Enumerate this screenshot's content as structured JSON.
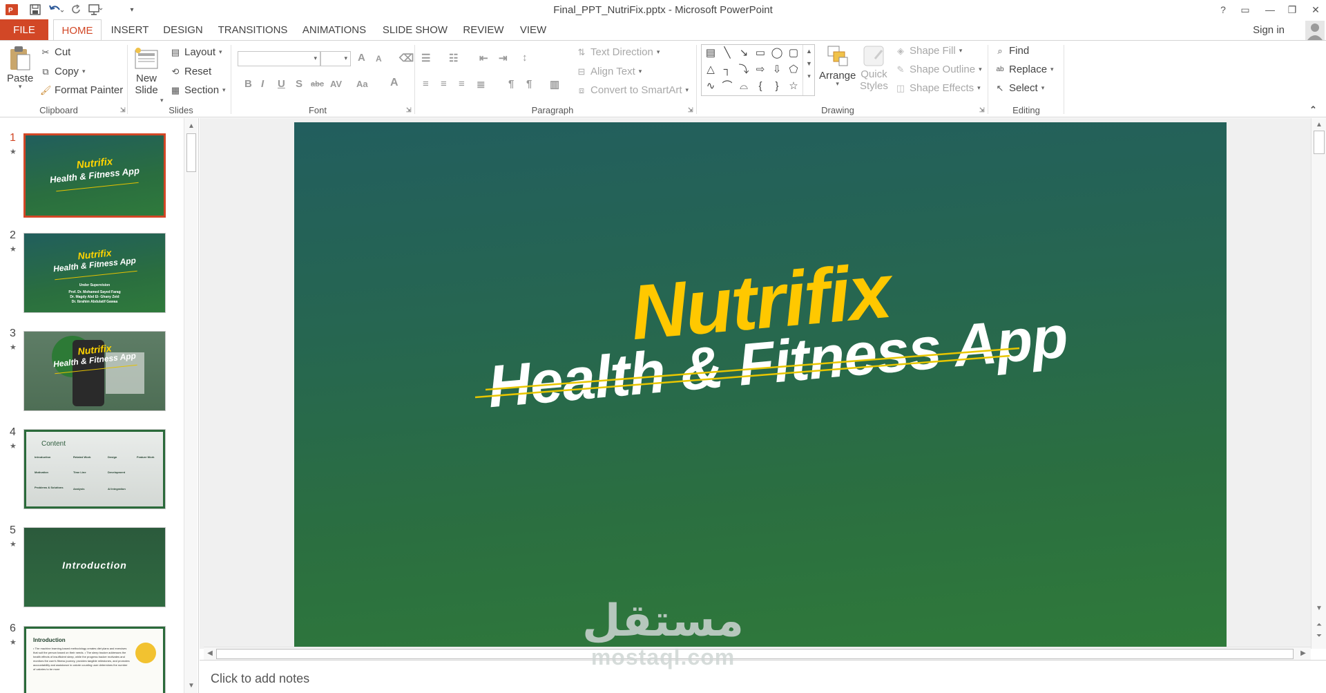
{
  "window": {
    "title": "Final_PPT_NutriFix.pptx - Microsoft PowerPoint",
    "controls": {
      "help": "?",
      "ribbon_display": "▭",
      "minimize": "—",
      "restore": "❐",
      "close": "✕"
    }
  },
  "tabs": [
    {
      "label": "FILE"
    },
    {
      "label": "HOME"
    },
    {
      "label": "INSERT"
    },
    {
      "label": "DESIGN"
    },
    {
      "label": "TRANSITIONS"
    },
    {
      "label": "ANIMATIONS"
    },
    {
      "label": "SLIDE SHOW"
    },
    {
      "label": "REVIEW"
    },
    {
      "label": "VIEW"
    }
  ],
  "account": {
    "signin": "Sign in"
  },
  "ribbon": {
    "clipboard": {
      "label": "Clipboard",
      "paste": "Paste",
      "cut": "Cut",
      "copy": "Copy",
      "format_painter": "Format Painter"
    },
    "slides": {
      "label": "Slides",
      "new_slide_1": "New",
      "new_slide_2": "Slide",
      "layout": "Layout",
      "reset": "Reset",
      "section": "Section"
    },
    "font": {
      "label": "Font",
      "bold": "B",
      "italic": "I",
      "underline": "U",
      "shadow": "S",
      "strike": "abc",
      "spacing": "AV",
      "case": "Aa",
      "color": "A",
      "grow": "A",
      "shrink": "A"
    },
    "paragraph": {
      "label": "Paragraph",
      "text_direction": "Text Direction",
      "align_text": "Align Text",
      "smartart": "Convert to SmartArt"
    },
    "drawing": {
      "label": "Drawing",
      "arrange": "Arrange",
      "quick_styles_1": "Quick",
      "quick_styles_2": "Styles",
      "shape_fill": "Shape Fill",
      "shape_outline": "Shape Outline",
      "shape_effects": "Shape Effects"
    },
    "editing": {
      "label": "Editing",
      "find": "Find",
      "replace": "Replace",
      "select": "Select"
    }
  },
  "thumbnails": [
    {
      "num": "1",
      "title1": "Nutrifix",
      "title2": "Health & Fitness App"
    },
    {
      "num": "2",
      "title1": "Nutrifix",
      "title2": "Health & Fitness App",
      "lines": [
        "Under Supervision",
        "Prof. Dr. Mohamed Sayed Farag",
        "Dr. Magdy Abd El- Ghany Zeid",
        "Dr. Ibrahim Abdulatif Gawaa"
      ]
    },
    {
      "num": "3",
      "title1": "Nutrifix",
      "title2": "Health & Fitness App"
    },
    {
      "num": "4",
      "heading": "Content",
      "items": [
        "Introduction",
        "Related Work",
        "Design",
        "Feature Work",
        "Motivation",
        "Time Line",
        "Development",
        "Problems & Solutions",
        "Analysis",
        "AI Integration"
      ]
    },
    {
      "num": "5",
      "heading": "Introduction"
    },
    {
      "num": "6",
      "heading": "Introduction",
      "text": "• The machine learning-based methodology creates diet plans and exercises that suit the person based on their needs. • The sleep tracker addresses the health effects of insufficient sleep, while the progress tracker motivates and monitors the user's fitness journey, provides tangible milestones, and promotes accountability and assistance in calorie counting user determines the number of calories to be more"
    }
  ],
  "slide": {
    "title1": "Nutrifix",
    "title2": "Health & Fitness App"
  },
  "notes": {
    "placeholder": "Click to add notes"
  },
  "watermark": {
    "arabic": "مستقل",
    "latin": "mostaql.com"
  },
  "colors": {
    "accent": "#d24726",
    "slide_top": "#225e5e",
    "slide_bottom": "#2f7a3a",
    "title_yellow": "#ffc800"
  }
}
